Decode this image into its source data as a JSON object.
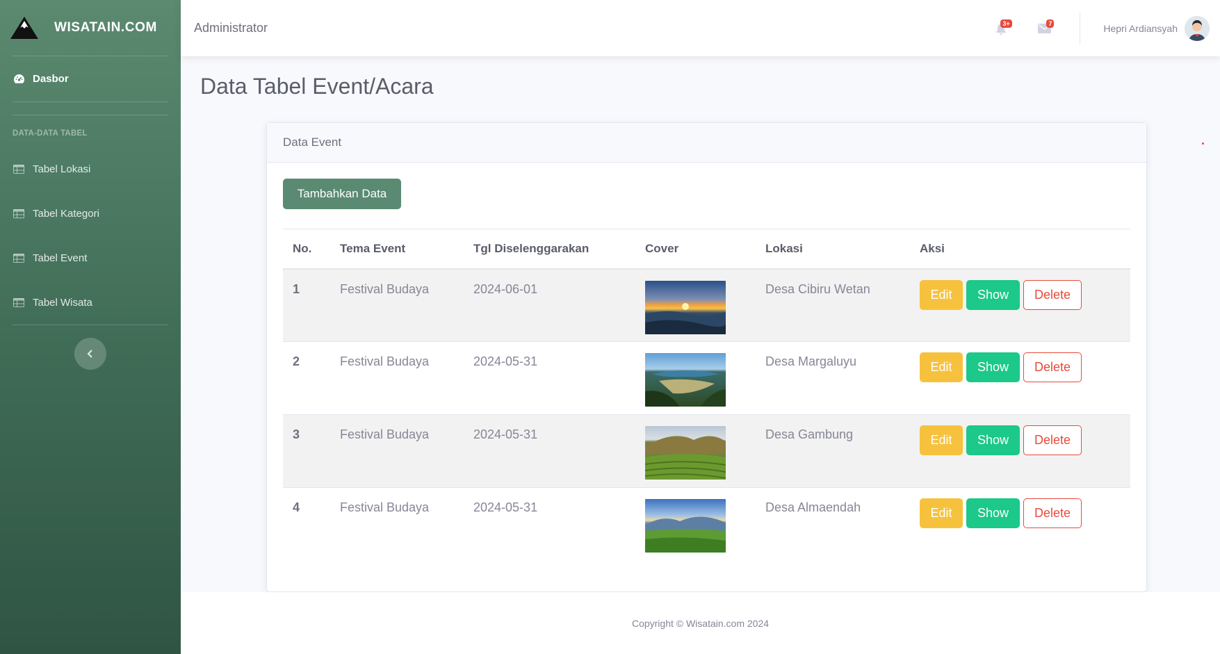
{
  "brand": {
    "name": "WISATAIN.COM",
    "logo_icon": "mountain-icon"
  },
  "sidebar": {
    "dashboard": {
      "label": "Dasbor",
      "icon": "gauge-icon"
    },
    "heading": "DATA-DATA TABEL",
    "items": [
      {
        "label": "Tabel Lokasi",
        "icon": "table-icon"
      },
      {
        "label": "Tabel Kategori",
        "icon": "table-icon"
      },
      {
        "label": "Tabel Event",
        "icon": "table-icon"
      },
      {
        "label": "Tabel Wisata",
        "icon": "table-icon"
      }
    ],
    "toggle_icon": "chevron-left-icon"
  },
  "topbar": {
    "title": "Administrator",
    "alerts_badge": "3+",
    "messages_badge": "7",
    "user_name": "Hepri Ardiansyah"
  },
  "page": {
    "title": "Data Tabel Event/Acara"
  },
  "card": {
    "header": "Data Event",
    "add_button": "Tambahkan Data",
    "columns": [
      "No.",
      "Tema Event",
      "Tgl Diselenggarakan",
      "Cover",
      "Lokasi",
      "Aksi"
    ],
    "rows": [
      {
        "no": "1",
        "tema": "Festival Budaya",
        "tanggal": "2024-06-01",
        "cover": "sunset-mountain-image",
        "lokasi": "Desa Cibiru Wetan"
      },
      {
        "no": "2",
        "tema": "Festival Budaya",
        "tanggal": "2024-05-31",
        "cover": "lake-valley-image",
        "lokasi": "Desa Margaluyu"
      },
      {
        "no": "3",
        "tema": "Festival Budaya",
        "tanggal": "2024-05-31",
        "cover": "tea-plantation-image",
        "lokasi": "Desa Gambung"
      },
      {
        "no": "4",
        "tema": "Festival Budaya",
        "tanggal": "2024-05-31",
        "cover": "green-hills-image",
        "lokasi": "Desa Almaendah"
      }
    ],
    "actions": {
      "edit": "Edit",
      "show": "Show",
      "delete": "Delete"
    }
  },
  "footer": {
    "text": "Copyright © Wisatain.com 2024"
  },
  "colors": {
    "sidebar_top": "#5b8a70",
    "sidebar_bottom": "#2f5444",
    "edit": "#f6c23e",
    "show": "#1cc88a",
    "delete": "#e74a3b"
  }
}
